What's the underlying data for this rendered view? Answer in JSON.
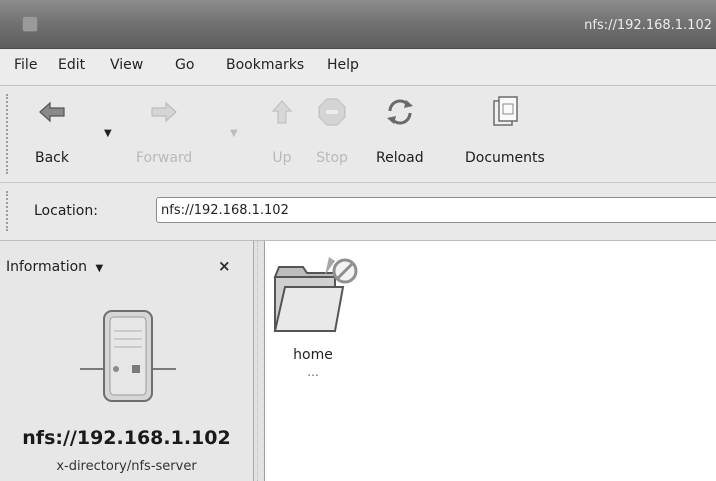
{
  "window": {
    "title": "nfs://192.168.1.102"
  },
  "menubar": {
    "items": [
      "File",
      "Edit",
      "View",
      "Go",
      "Bookmarks",
      "Help"
    ]
  },
  "toolbar": {
    "back_label": "Back",
    "forward_label": "Forward",
    "up_label": "Up",
    "stop_label": "Stop",
    "reload_label": "Reload",
    "documents_label": "Documents",
    "icons": {
      "back": "back-arrow-icon",
      "forward": "forward-arrow-icon",
      "up": "up-arrow-icon",
      "stop": "stop-icon",
      "reload": "reload-icon",
      "documents": "documents-icon"
    }
  },
  "location": {
    "label": "Location:",
    "value": "nfs://192.168.1.102"
  },
  "sidepane": {
    "selector_label": "Information",
    "close_symbol": "×",
    "title": "nfs://192.168.1.102",
    "mime_type": "x-directory/nfs-server",
    "icon": "nfs-server-icon"
  },
  "files": [
    {
      "name": "home",
      "sub": "...",
      "icon": "folder-icon",
      "emblem": "unreadable-emblem-icon"
    }
  ],
  "colors": {
    "titlebar": "#6e6e6e",
    "background": "#e6e6e6",
    "content": "#ffffff"
  }
}
